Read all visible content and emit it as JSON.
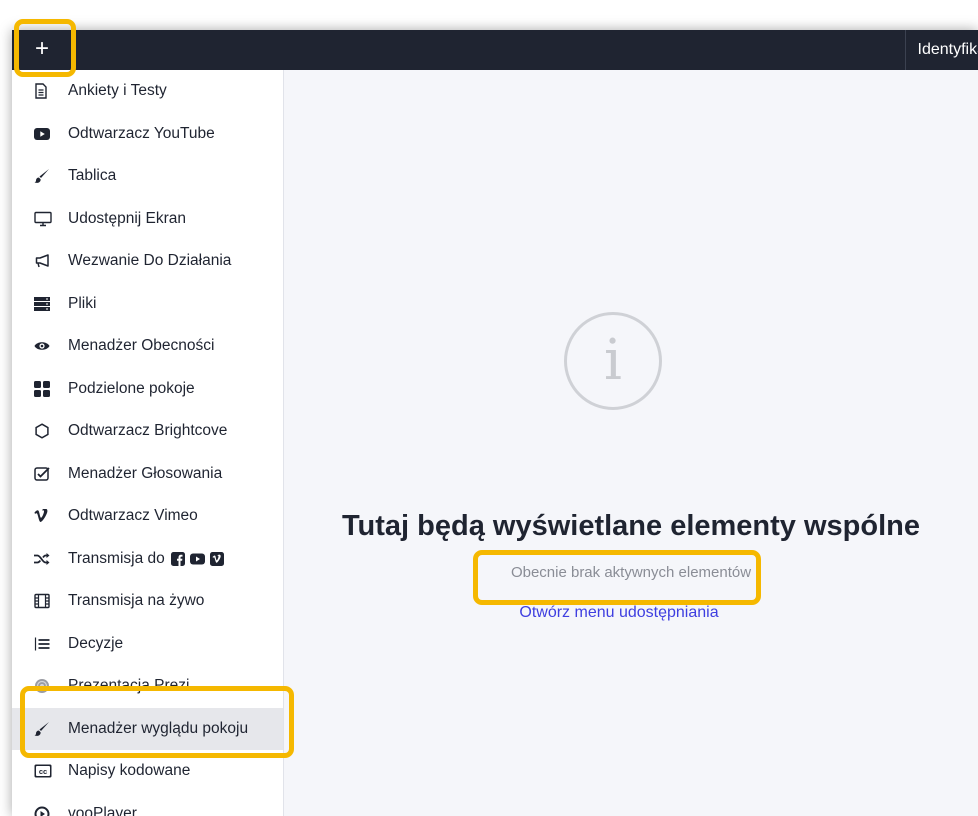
{
  "topbar": {
    "add_label": "+",
    "right_label": "Identyfika"
  },
  "sidebar": {
    "items": [
      {
        "label": "Ankiety i Testy",
        "icon": "document-icon"
      },
      {
        "label": "Odtwarzacz YouTube",
        "icon": "youtube-icon"
      },
      {
        "label": "Tablica",
        "icon": "brush-icon"
      },
      {
        "label": "Udostępnij Ekran",
        "icon": "monitor-icon"
      },
      {
        "label": "Wezwanie Do Działania",
        "icon": "megaphone-icon"
      },
      {
        "label": "Pliki",
        "icon": "files-icon"
      },
      {
        "label": "Menadżer Obecności",
        "icon": "eye-icon"
      },
      {
        "label": "Podzielone pokoje",
        "icon": "grid-icon"
      },
      {
        "label": "Odtwarzacz Brightcove",
        "icon": "brightcove-icon"
      },
      {
        "label": "Menadżer Głosowania",
        "icon": "checkbox-icon"
      },
      {
        "label": "Odtwarzacz Vimeo",
        "icon": "vimeo-icon"
      },
      {
        "label": "Transmisja do",
        "icon": "shuffle-icon"
      },
      {
        "label": "Transmisja na żywo",
        "icon": "film-icon"
      },
      {
        "label": "Decyzje",
        "icon": "list-icon"
      },
      {
        "label": "Prezentacja Prezi",
        "icon": "prezi-icon"
      },
      {
        "label": "Menadżer wyglądu pokoju",
        "icon": "brush-icon"
      },
      {
        "label": "Napisy kodowane",
        "icon": "closed-captions-icon"
      },
      {
        "label": "vooPlayer",
        "icon": "play-circle-icon"
      }
    ]
  },
  "main": {
    "headline": "Tutaj będą wyświetlane elementy wspólne",
    "subtext": "Obecnie brak aktywnych elementów",
    "open_link": "Otwórz menu udostępniania",
    "info_glyph": "i"
  },
  "colors": {
    "topbar_bg": "#1f2431",
    "highlight": "#f5b800",
    "link": "#3f3fe0",
    "active_item_bg": "#e6e7eb"
  }
}
